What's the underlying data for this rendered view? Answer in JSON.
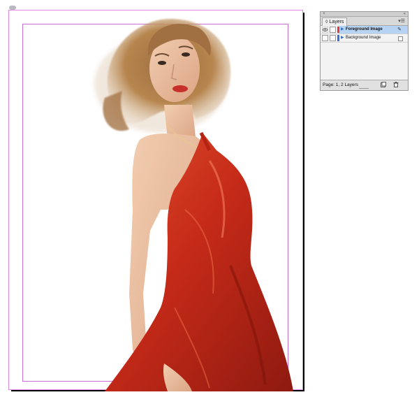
{
  "layers_panel": {
    "tab_label": "◊ Layers",
    "close_glyph": "×",
    "collapse_glyph": "«",
    "menu_glyph": "▾☰",
    "layers": [
      {
        "name": "Foreground Image",
        "selected": true,
        "visible": true,
        "color": "#e43a3a",
        "pen": "✎"
      },
      {
        "name": "Background Image",
        "selected": false,
        "visible": false,
        "color": "#3a6fd8"
      }
    ],
    "footer_text": "Page: 1, 2 Layers",
    "icons": [
      "new-layer-icon",
      "trash-icon"
    ]
  },
  "document": {
    "guide_color": "#c86fd6",
    "image": "woman-red-dress-photo"
  }
}
